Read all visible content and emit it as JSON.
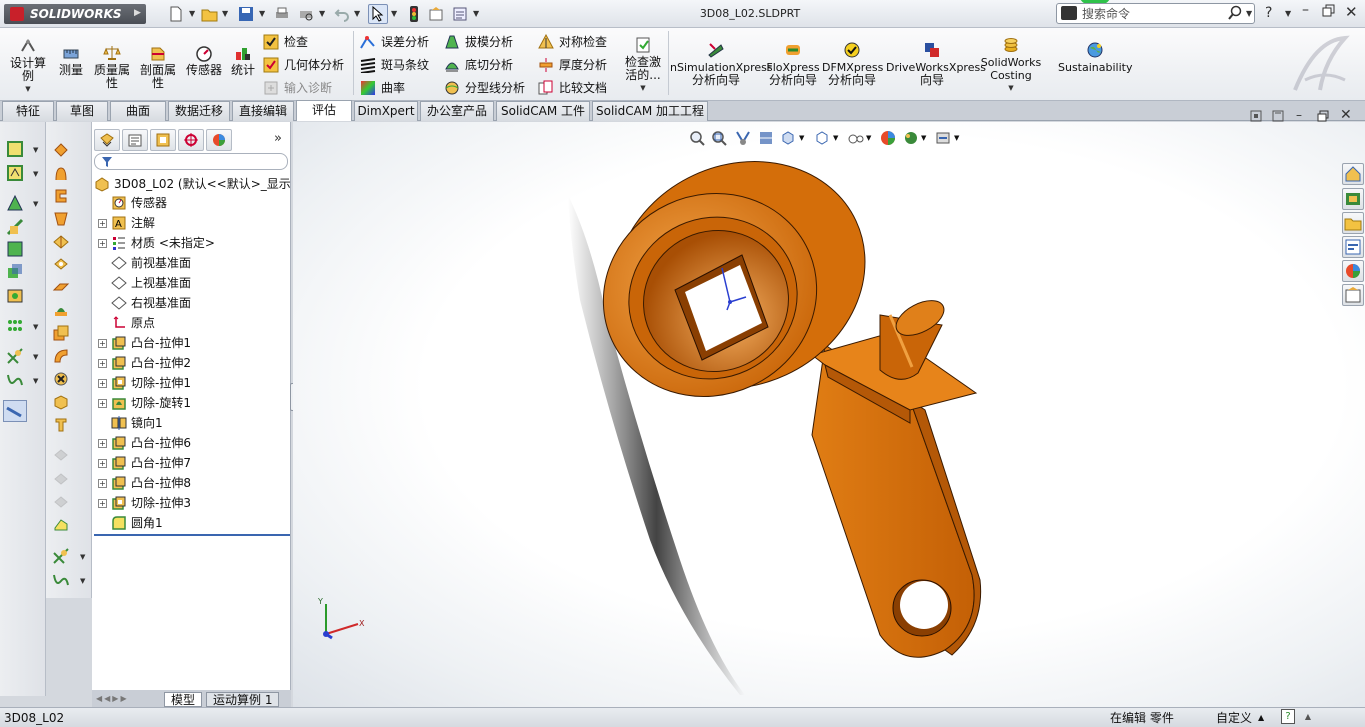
{
  "app": {
    "name": "SOLIDWORKS",
    "document_title": "3D08_L02.SLDPRT"
  },
  "search": {
    "placeholder": "搜索命令"
  },
  "ribbon": {
    "large": [
      {
        "id": "design-study",
        "label": "设计算例"
      },
      {
        "id": "measure",
        "label": "测量"
      },
      {
        "id": "mass-props",
        "label": "质量属性"
      },
      {
        "id": "section-props",
        "label": "剖面属性"
      },
      {
        "id": "sensor",
        "label": "传感器"
      },
      {
        "id": "statistics",
        "label": "统计"
      }
    ],
    "small_col1": [
      {
        "label": "检查",
        "enabled": true
      },
      {
        "label": "几何体分析",
        "enabled": true
      },
      {
        "label": "输入诊断",
        "enabled": false
      }
    ],
    "small_col2": [
      {
        "label": "误差分析"
      },
      {
        "label": "斑马条纹"
      },
      {
        "label": "曲率"
      }
    ],
    "small_col3": [
      {
        "label": "拔模分析"
      },
      {
        "label": "底切分析"
      },
      {
        "label": "分型线分析"
      }
    ],
    "small_col4": [
      {
        "label": "对称检查"
      },
      {
        "label": "厚度分析"
      },
      {
        "label": "比较文档"
      }
    ],
    "check_active": {
      "label": "检查激活的..."
    },
    "xpress": [
      {
        "line1": "nSimulationXpress",
        "line2": "分析向导"
      },
      {
        "line1": "FloXpress",
        "line2": "分析向导"
      },
      {
        "line1": "DFMXpress",
        "line2": "分析向导"
      },
      {
        "line1": "DriveWorksXpress",
        "line2": "向导"
      },
      {
        "line1": "SolidWorks",
        "line2": "Costing"
      },
      {
        "line1": "Sustainability",
        "line2": ""
      }
    ]
  },
  "tabs": [
    "特征",
    "草图",
    "曲面",
    "数据迁移",
    "直接编辑",
    "评估",
    "DimXpert",
    "办公室产品",
    "SolidCAM 工件",
    "SolidCAM 加工工程"
  ],
  "active_tab": "评估",
  "tree": {
    "root": "3D08_L02  (默认<<默认>_显示",
    "items": [
      {
        "label": "传感器",
        "icon": "sensor-icon",
        "expandable": false
      },
      {
        "label": "注解",
        "icon": "annotation-icon",
        "expandable": true
      },
      {
        "label": "材质 <未指定>",
        "icon": "material-icon",
        "expandable": true
      },
      {
        "label": "前视基准面",
        "icon": "plane-icon",
        "expandable": false
      },
      {
        "label": "上视基准面",
        "icon": "plane-icon",
        "expandable": false
      },
      {
        "label": "右视基准面",
        "icon": "plane-icon",
        "expandable": false
      },
      {
        "label": "原点",
        "icon": "origin-icon",
        "expandable": false
      },
      {
        "label": "凸台-拉伸1",
        "icon": "extrude-boss-icon",
        "expandable": true
      },
      {
        "label": "凸台-拉伸2",
        "icon": "extrude-boss-icon",
        "expandable": true
      },
      {
        "label": "切除-拉伸1",
        "icon": "extrude-cut-icon",
        "expandable": true
      },
      {
        "label": "切除-旋转1",
        "icon": "revolve-cut-icon",
        "expandable": true
      },
      {
        "label": "镜向1",
        "icon": "mirror-icon",
        "expandable": false
      },
      {
        "label": "凸台-拉伸6",
        "icon": "extrude-boss-icon",
        "expandable": true
      },
      {
        "label": "凸台-拉伸7",
        "icon": "extrude-boss-icon",
        "expandable": true
      },
      {
        "label": "凸台-拉伸8",
        "icon": "extrude-boss-icon",
        "expandable": true
      },
      {
        "label": "切除-拉伸3",
        "icon": "extrude-cut-icon",
        "expandable": true
      },
      {
        "label": "圆角1",
        "icon": "fillet-icon",
        "expandable": false
      }
    ]
  },
  "bottom_tabs": [
    "模型",
    "运动算例 1"
  ],
  "status": {
    "filename": "3D08_L02",
    "mode": "在编辑 零件",
    "units": "自定义"
  },
  "colors": {
    "part": "#d9720c",
    "part_dark": "#a84f05",
    "part_light": "#f0993a",
    "accent": "#3a66b0"
  }
}
